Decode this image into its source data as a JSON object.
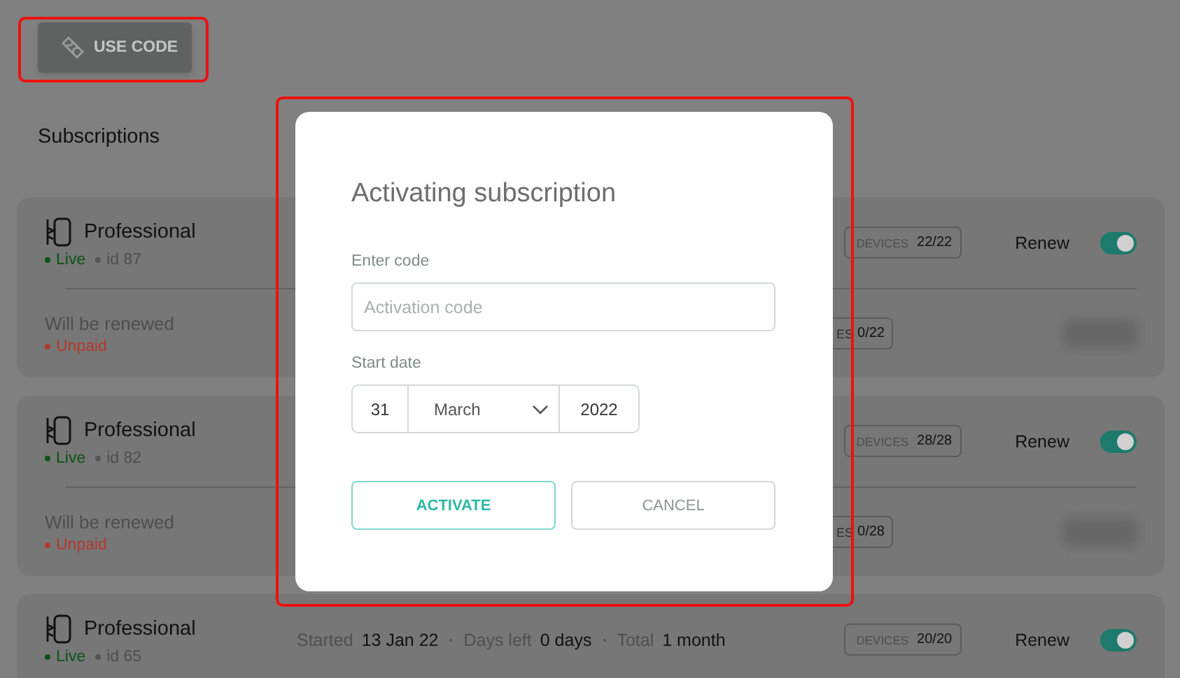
{
  "use_code": {
    "label": "USE CODE",
    "highlighted": true
  },
  "section_title": "Subscriptions",
  "subscriptions": [
    {
      "name": "Professional",
      "status": {
        "label": "Live",
        "color": "#0b5417"
      },
      "id": "id 87",
      "devices": {
        "label": "DEVICES",
        "value": "22/22"
      },
      "renew": {
        "label": "Renew",
        "on": true
      },
      "renewal": {
        "text": "Will be renewed",
        "payment": {
          "label": "Unpaid",
          "color": "#b23a2c"
        },
        "devices_partial": {
          "label": "ES",
          "value": "0/22"
        },
        "amount_blurred": true
      }
    },
    {
      "name": "Professional",
      "status": {
        "label": "Live",
        "color": "#0b5417"
      },
      "id": "id 82",
      "devices": {
        "label": "DEVICES",
        "value": "28/28"
      },
      "renew": {
        "label": "Renew",
        "on": true
      },
      "renewal": {
        "text": "Will be renewed",
        "payment": {
          "label": "Unpaid",
          "color": "#b23a2c"
        },
        "devices_partial": {
          "label": "ES",
          "value": "0/28"
        },
        "amount_blurred": true
      }
    },
    {
      "name": "Professional",
      "status": {
        "label": "Live",
        "color": "#0b5417"
      },
      "id": "id 65",
      "details": [
        {
          "label": "Started",
          "value": "13 Jan 22"
        },
        {
          "label": "Days left",
          "value": "0 days"
        },
        {
          "label": "Total",
          "value": "1 month"
        }
      ],
      "devices": {
        "label": "DEVICES",
        "value": "20/20"
      },
      "renew": {
        "label": "Renew",
        "on": true
      }
    }
  ],
  "dialog": {
    "title": "Activating subscription",
    "highlighted": true,
    "code_label": "Enter code",
    "code_placeholder": "Activation code",
    "date_label": "Start date",
    "day": "31",
    "month": "March",
    "year": "2022",
    "buttons": [
      {
        "label": "ACTIVATE",
        "kind": "primary"
      },
      {
        "label": "CANCEL",
        "kind": "secondary"
      }
    ]
  }
}
